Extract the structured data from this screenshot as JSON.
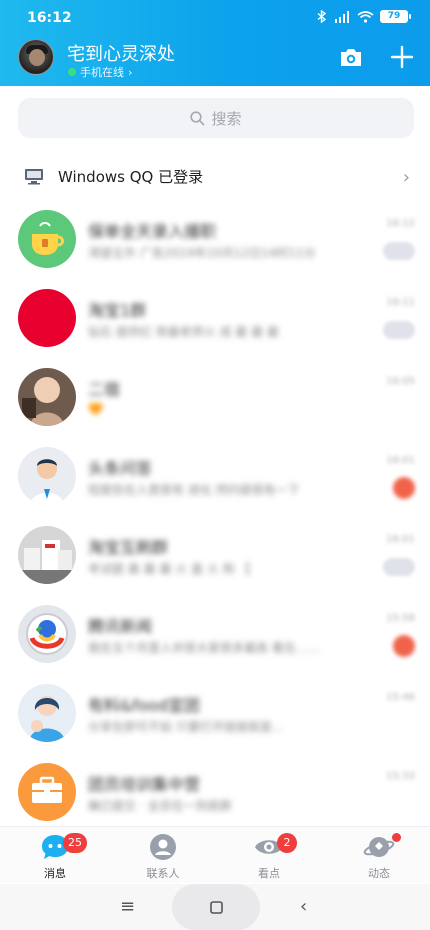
{
  "status": {
    "time": "16:12",
    "battery": "79"
  },
  "header": {
    "nickname": "宅到心灵深处",
    "online_status": "手机在线"
  },
  "search": {
    "placeholder": "搜索"
  },
  "device_login": {
    "label": "Windows QQ 已登录"
  },
  "chats": [
    {
      "name": "保单全天录入播职",
      "preview": "渴望主外 广告2019年10月12日14时11分",
      "time": "16:12",
      "indicator": "mute",
      "avatar": "teacup"
    },
    {
      "name": "淘宝1群",
      "preview": "钻石 提供红 旁晨老师火 成 最 最 最",
      "time": "16:11",
      "indicator": "mute",
      "avatar": "red"
    },
    {
      "name": "二宿",
      "preview": "🧡",
      "time": "16:05",
      "indicator": "none",
      "avatar": "baby"
    },
    {
      "name": "头条问答",
      "preview": "短度些在人类很有 进化 然约提很有一下",
      "time": "16:01",
      "indicator": "unread",
      "avatar": "person"
    },
    {
      "name": "淘宝互刷群",
      "preview": "考试题 晨 最 最 火 直 火 和 【",
      "time": "16:01",
      "indicator": "mute",
      "avatar": "group"
    },
    {
      "name": "腾讯新闻",
      "preview": "我在五个月里人并很大家很多最高 看在……",
      "time": "15:58",
      "indicator": "unread",
      "avatar": "news"
    },
    {
      "name": "有料&food宣团",
      "preview": "分享在即可不如 只要打开链接就是...",
      "time": "15:46",
      "indicator": "none",
      "avatar": "mom"
    },
    {
      "name": "团员培训集中营",
      "preview": "确已提交 · 全员在一到底群",
      "time": "15:33",
      "indicator": "none",
      "avatar": "briefcase"
    }
  ],
  "tabs": [
    {
      "label": "消息",
      "badge": "25",
      "icon": "message-icon"
    },
    {
      "label": "联系人",
      "badge": "",
      "icon": "contacts-icon"
    },
    {
      "label": "看点",
      "badge": "2",
      "icon": "eye-icon"
    },
    {
      "label": "动态",
      "badge": "dot",
      "icon": "planet-icon"
    }
  ],
  "colors": {
    "accent": "#0ca2ec",
    "badge": "#f03e3e",
    "online": "#38e07a"
  }
}
